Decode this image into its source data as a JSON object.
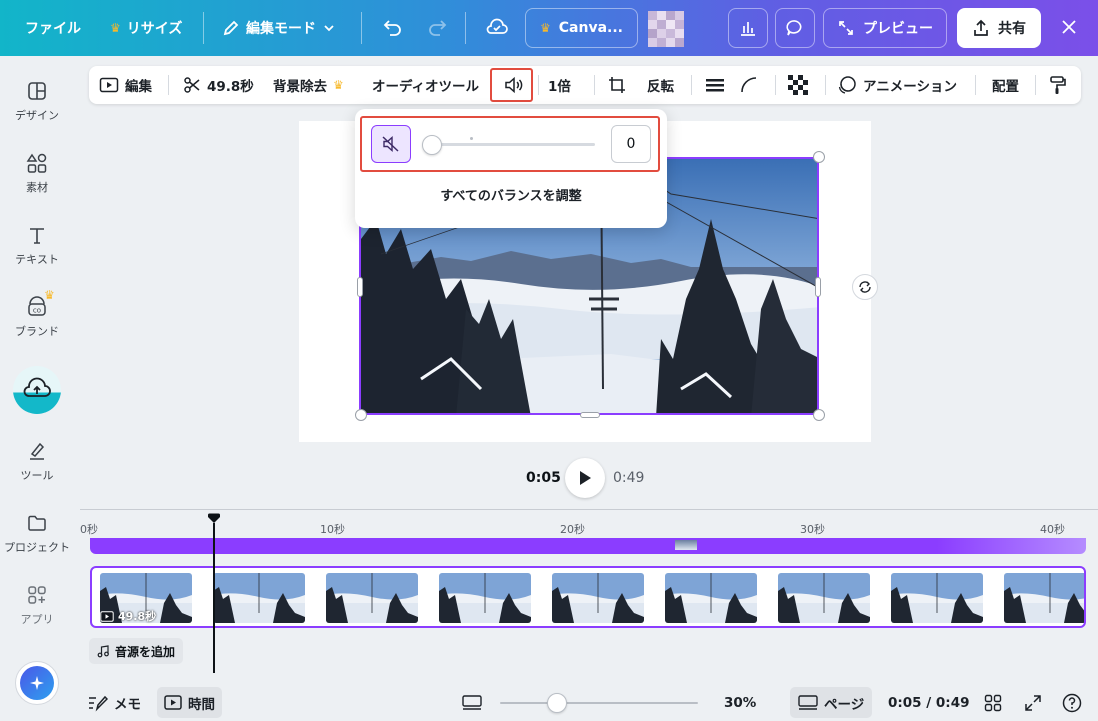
{
  "topbar": {
    "file": "ファイル",
    "resize": "リサイズ",
    "edit_mode": "編集モード",
    "canva_pro": "Canva...",
    "preview": "プレビュー",
    "share": "共有"
  },
  "sidebar": {
    "items": [
      {
        "label": "デザイン"
      },
      {
        "label": "素材"
      },
      {
        "label": "テキスト"
      },
      {
        "label": "ブランド"
      },
      {
        "label": ""
      },
      {
        "label": "ツール"
      },
      {
        "label": "プロジェクト"
      },
      {
        "label": "アプリ"
      }
    ]
  },
  "toolbar": {
    "edit": "編集",
    "duration": "49.8秒",
    "bg_remove": "背景除去",
    "audio_tools": "オーディオツール",
    "speed": "1倍",
    "flip": "反転",
    "animation": "アニメーション",
    "position": "配置"
  },
  "volume_popover": {
    "value": "0",
    "balance_label": "すべてのバランスを調整"
  },
  "playback": {
    "current": "0:05",
    "total": "0:49"
  },
  "timeline": {
    "ticks": [
      "0秒",
      "10秒",
      "20秒",
      "30秒",
      "40秒"
    ],
    "clip_duration": "49.8秒",
    "add_audio": "音源を追加",
    "playhead_fraction": 0.1
  },
  "bottombar": {
    "notes": "メモ",
    "time": "時間",
    "zoom": "30%",
    "zoom_level_fraction": 0.29,
    "pages": "ページ",
    "time_display": "0:05 / 0:49"
  },
  "colors": {
    "accent": "#8b3dff",
    "highlight": "#e24c3f",
    "crown": "#f7b92b"
  }
}
